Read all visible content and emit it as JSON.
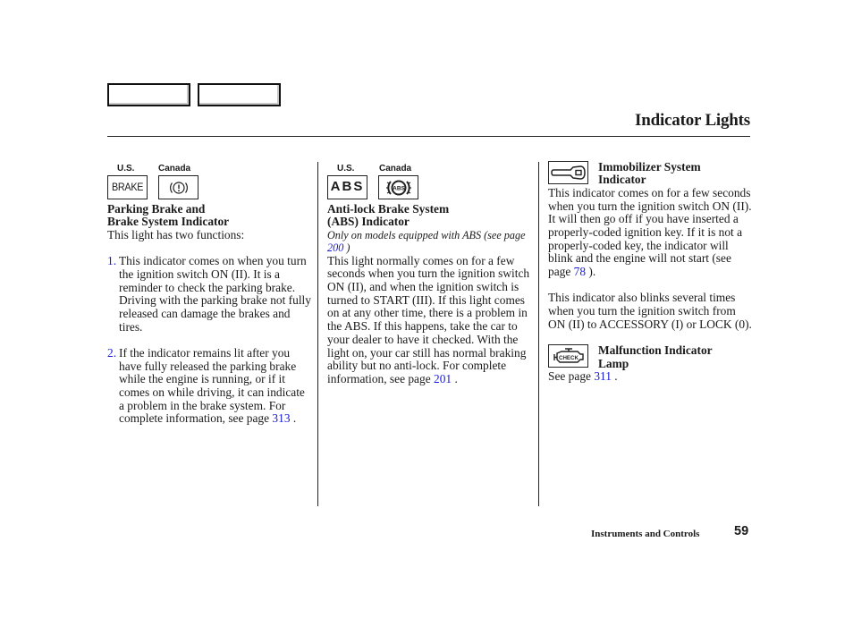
{
  "header": {
    "title": "Indicator Lights"
  },
  "columns": {
    "parking_brake": {
      "region_labels": [
        "U.S.",
        "Canada"
      ],
      "icons": [
        "brake-text-icon",
        "brake-circle-exclamation-icon"
      ],
      "us_icon_text": "BRAKE",
      "heading_line1": "Parking Brake and",
      "heading_line2": "Brake System Indicator",
      "intro": "This light has two functions:",
      "items": [
        {
          "number": "1.",
          "text": "This indicator comes on when you turn the ignition switch ON (II). It is a reminder to check the parking brake. Driving with the parking brake not fully released can damage the brakes and tires."
        },
        {
          "number": "2.",
          "text_before_link": "If the indicator remains lit after you have fully released the parking brake while the engine is running, or if it comes on while driving, it can indicate a problem in the brake system. For complete information, see page ",
          "link": "313",
          "text_after_link": " ."
        }
      ]
    },
    "abs": {
      "region_labels": [
        "U.S.",
        "Canada"
      ],
      "icons": [
        "abs-text-icon",
        "abs-circle-icon"
      ],
      "us_icon_text": "ABS",
      "canada_icon_text": "ABS",
      "heading_line1": "Anti-lock Brake System",
      "heading_line2": "(ABS) Indicator",
      "note_before_link": "Only on models equipped with ABS (see page ",
      "note_link": "200",
      "note_after_link": " )",
      "body_before_link": "This light normally comes on for a few seconds when you turn the ignition switch ON (II), and when the ignition switch is turned to START (III). If this light comes on at any other time, there is a problem in the ABS. If this happens, take the car to your dealer to have it checked. With the light on, your car still has normal braking ability but no anti-lock. For complete information, see page ",
      "body_link": "201",
      "body_after_link": " ."
    },
    "immobilizer": {
      "icon": "key-icon",
      "heading_line1": "Immobilizer System",
      "heading_line2": "Indicator",
      "para1_before_link": "This indicator comes on for a few seconds when you turn the ignition switch ON (II). It will then go off if you have inserted a properly-coded ignition key. If it is not a properly-coded key, the indicator will blink and the engine will not start (see page ",
      "para1_link": "78",
      "para1_after_link": " ).",
      "para2": "This indicator also blinks several times when you turn the ignition switch from ON (II) to ACCESSORY (I) or LOCK (0)."
    },
    "malfunction": {
      "icon": "check-engine-icon",
      "icon_text": "CHECK",
      "heading_line1": "Malfunction Indicator",
      "heading_line2": "Lamp",
      "body_before_link": "See page ",
      "body_link": "311",
      "body_after_link": " ."
    }
  },
  "footer": {
    "section": "Instruments and Controls",
    "page_number": "59"
  },
  "colors": {
    "link": "#1a1adb",
    "text": "#1a1a1a",
    "rule": "#222222"
  }
}
